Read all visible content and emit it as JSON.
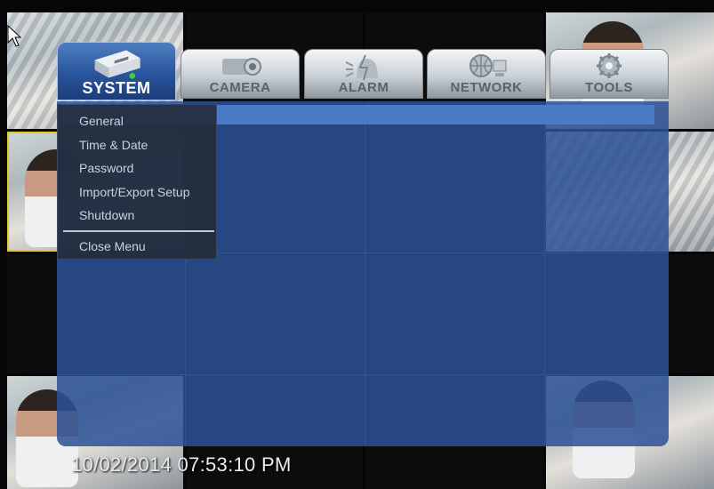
{
  "tabs": [
    {
      "label": "SYSTEM",
      "icon": "dvr-recorder-icon",
      "active": true
    },
    {
      "label": "CAMERA",
      "icon": "camera-icon",
      "active": false
    },
    {
      "label": "ALARM",
      "icon": "alarm-icon",
      "active": false
    },
    {
      "label": "NETWORK",
      "icon": "network-icon",
      "active": false
    },
    {
      "label": "TOOLS",
      "icon": "tools-icon",
      "active": false
    }
  ],
  "menu": {
    "items": [
      "General",
      "Time & Date",
      "Password",
      "Import/Export Setup",
      "Shutdown"
    ],
    "close_label": "Close Menu"
  },
  "overlay": {
    "timestamp": "10/02/2014 07:53:10 PM"
  },
  "colors": {
    "panel": "#2c5296",
    "header": "#4a7bc6",
    "selection_outline": "#e6c824"
  }
}
